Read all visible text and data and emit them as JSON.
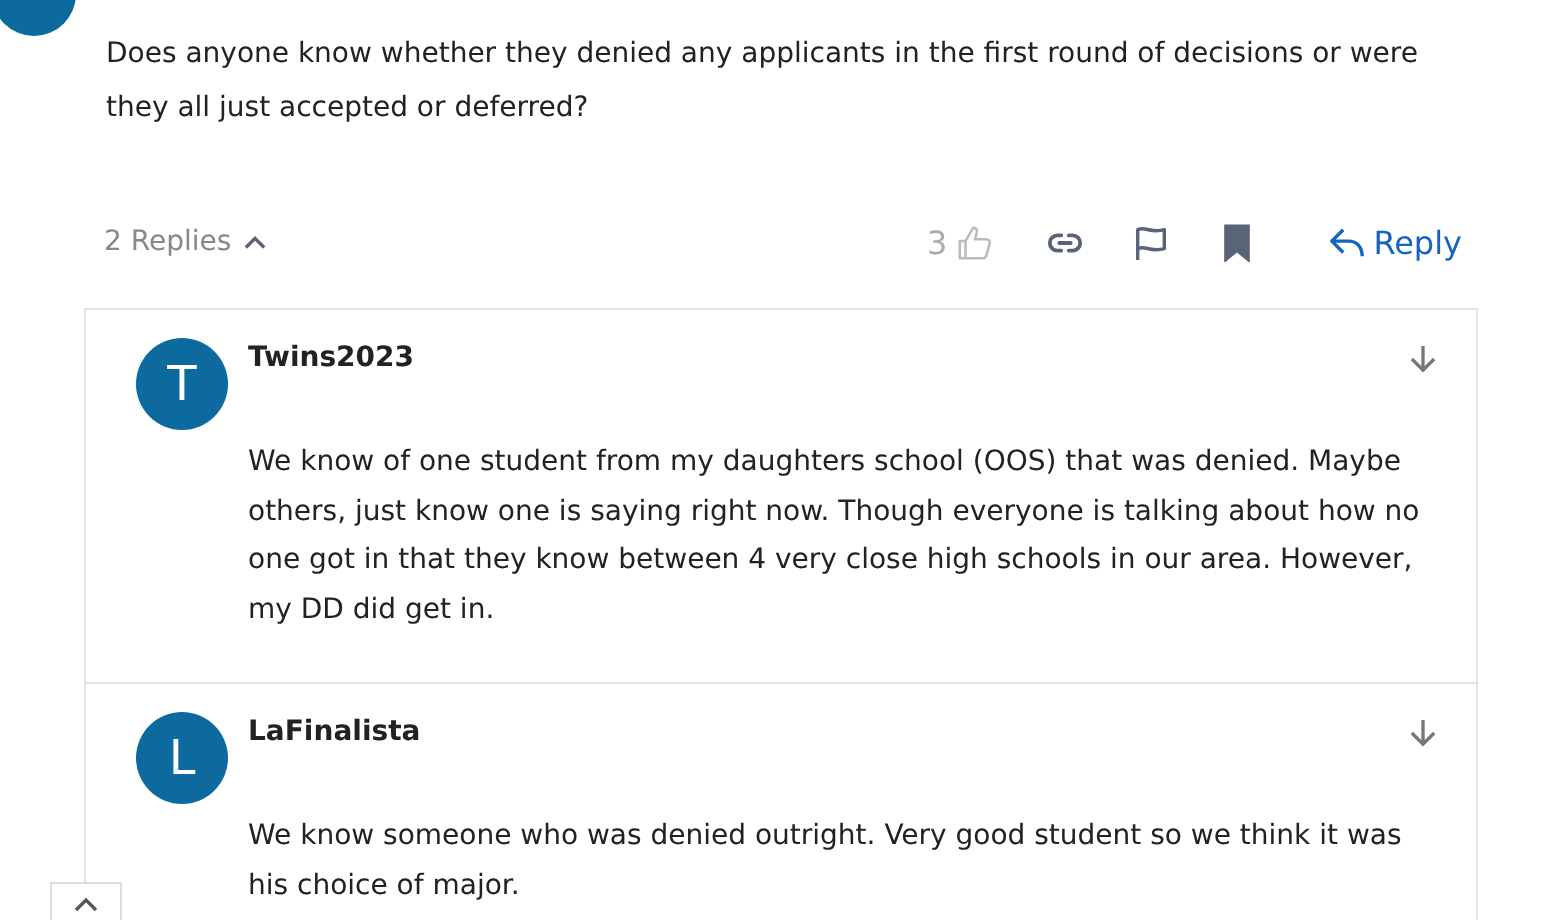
{
  "post": {
    "body": "Does anyone know whether they denied any applicants in the first round of decisions or were they all just accepted or deferred?"
  },
  "actions": {
    "replies_toggle": "2 Replies",
    "expanded": true,
    "likes": "3",
    "reply": "Reply",
    "bookmarked": true
  },
  "replies": [
    {
      "avatar": "T",
      "author": "Twins2023",
      "body": "We know of one student from my daughters school (OOS) that was denied. Maybe others, just know one is saying right now. Though everyone is talking about how no one got in that they know between 4 very close high schools in our area. However, my DD did get in."
    },
    {
      "avatar": "L",
      "author": "LaFinalista",
      "body": "We know someone who was denied outright. Very good student so we think it was his choice of major."
    }
  ]
}
